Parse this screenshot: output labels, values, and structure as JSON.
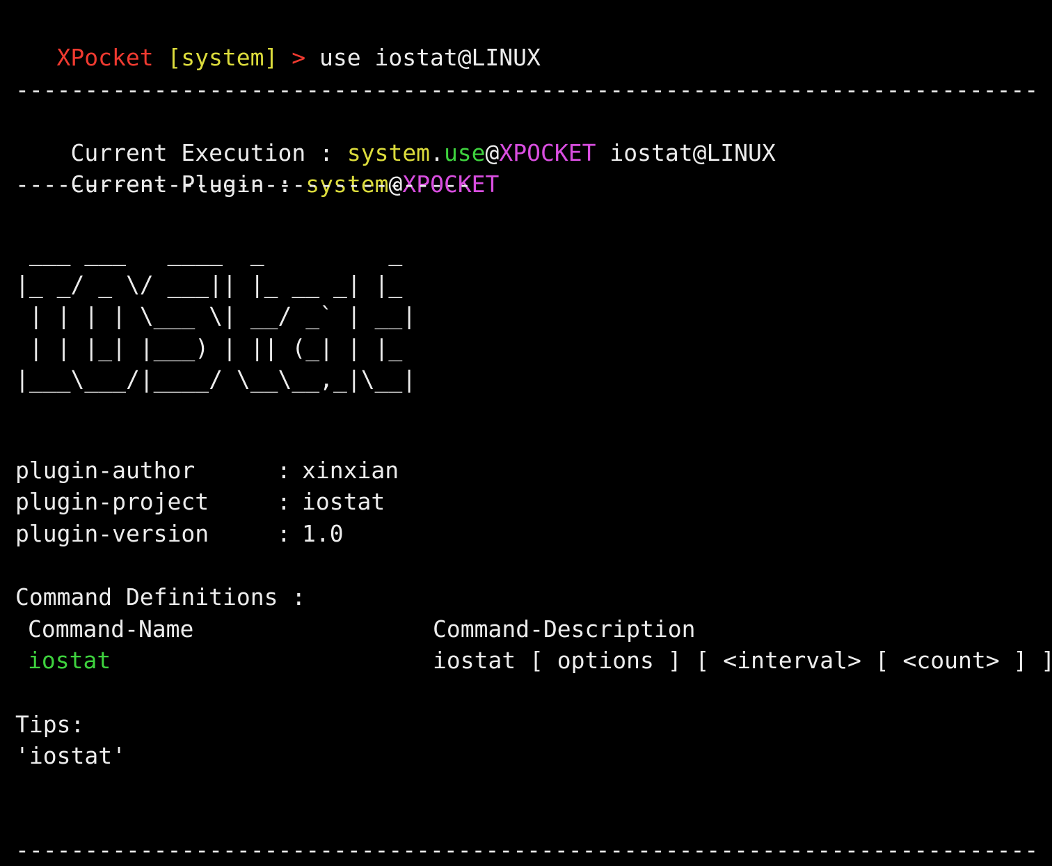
{
  "prompt": {
    "app": "XPocket",
    "context": "[system]",
    "arrow": ">",
    "command": "use iostat@LINUX"
  },
  "separators": {
    "top": "--------------------------------------------------------------------------",
    "mid": "---------------------------------",
    "bottom": "--------------------------------------------------------------------------"
  },
  "execution": {
    "label": "Current Execution : ",
    "ns": "system",
    "dot": ".",
    "cmd": "use",
    "at": "@",
    "target": "XPOCKET",
    "arg": " iostat@LINUX"
  },
  "plugin_line": {
    "label": "Current Plugin : ",
    "ns": "system",
    "at": "@",
    "target": "XPOCKET"
  },
  "banner": " ___ ___   ____  _         _\n|_ _/ _ \\/ ___|| |_ __ _| |_\n | | | | \\___ \\| __/ _` | __|\n | | |_| |___) | || (_| | |_\n|___\\___/|____/ \\__\\__,_|\\__|",
  "info": {
    "author": {
      "key": "plugin-author",
      "sep": ": ",
      "value": "xinxian"
    },
    "project": {
      "key": "plugin-project",
      "sep": ": ",
      "value": "iostat"
    },
    "version": {
      "key": "plugin-version",
      "sep": ": ",
      "value": "1.0"
    }
  },
  "commands": {
    "title": "Command Definitions :",
    "header_name": "Command-Name",
    "header_desc": "Command-Description",
    "rows": [
      {
        "name": "iostat",
        "desc": "iostat [ options ] [ <interval> [ <count> ] ]"
      }
    ]
  },
  "tips": {
    "label": "Tips:",
    "value": "'iostat'"
  },
  "colors": {
    "background": "#000000",
    "text": "#ececec",
    "prompt_red": "#ef3a30",
    "yellow": "#dcdc3c",
    "green": "#3ed23e",
    "magenta": "#d94ee0"
  }
}
